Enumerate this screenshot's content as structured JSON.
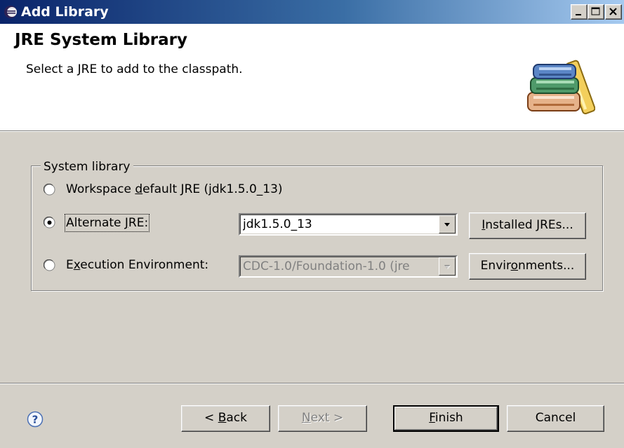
{
  "window": {
    "title": "Add Library",
    "minimize_icon": "minimize-icon",
    "maximize_icon": "maximize-icon",
    "close_icon": "close-icon"
  },
  "header": {
    "title": "JRE System Library",
    "description": "Select a JRE to add to the classpath.",
    "image_icon": "books-library-icon"
  },
  "group": {
    "legend": "System library",
    "options": [
      {
        "label": "Workspace default JRE (jdk1.5.0_13)",
        "mnemonic": "d",
        "selected": false
      },
      {
        "label": "Alternate JRE:",
        "mnemonic": "J",
        "selected": true
      },
      {
        "label": "Execution Environment:",
        "mnemonic": "x",
        "selected": false
      }
    ],
    "alternate_jre_value": "jdk1.5.0_13",
    "execution_env_value": "CDC-1.0/Foundation-1.0 (jre",
    "installed_jres_button": "Installed JREs...",
    "environments_button": "Environments..."
  },
  "footer": {
    "help_icon": "help-icon",
    "back_button": "< Back",
    "next_button": "Next >",
    "finish_button": "Finish",
    "cancel_button": "Cancel"
  },
  "colors": {
    "titlebar_start": "#0a246a",
    "titlebar_end": "#a6caf0",
    "face": "#d4d0c8",
    "banner": "#ffffff"
  }
}
